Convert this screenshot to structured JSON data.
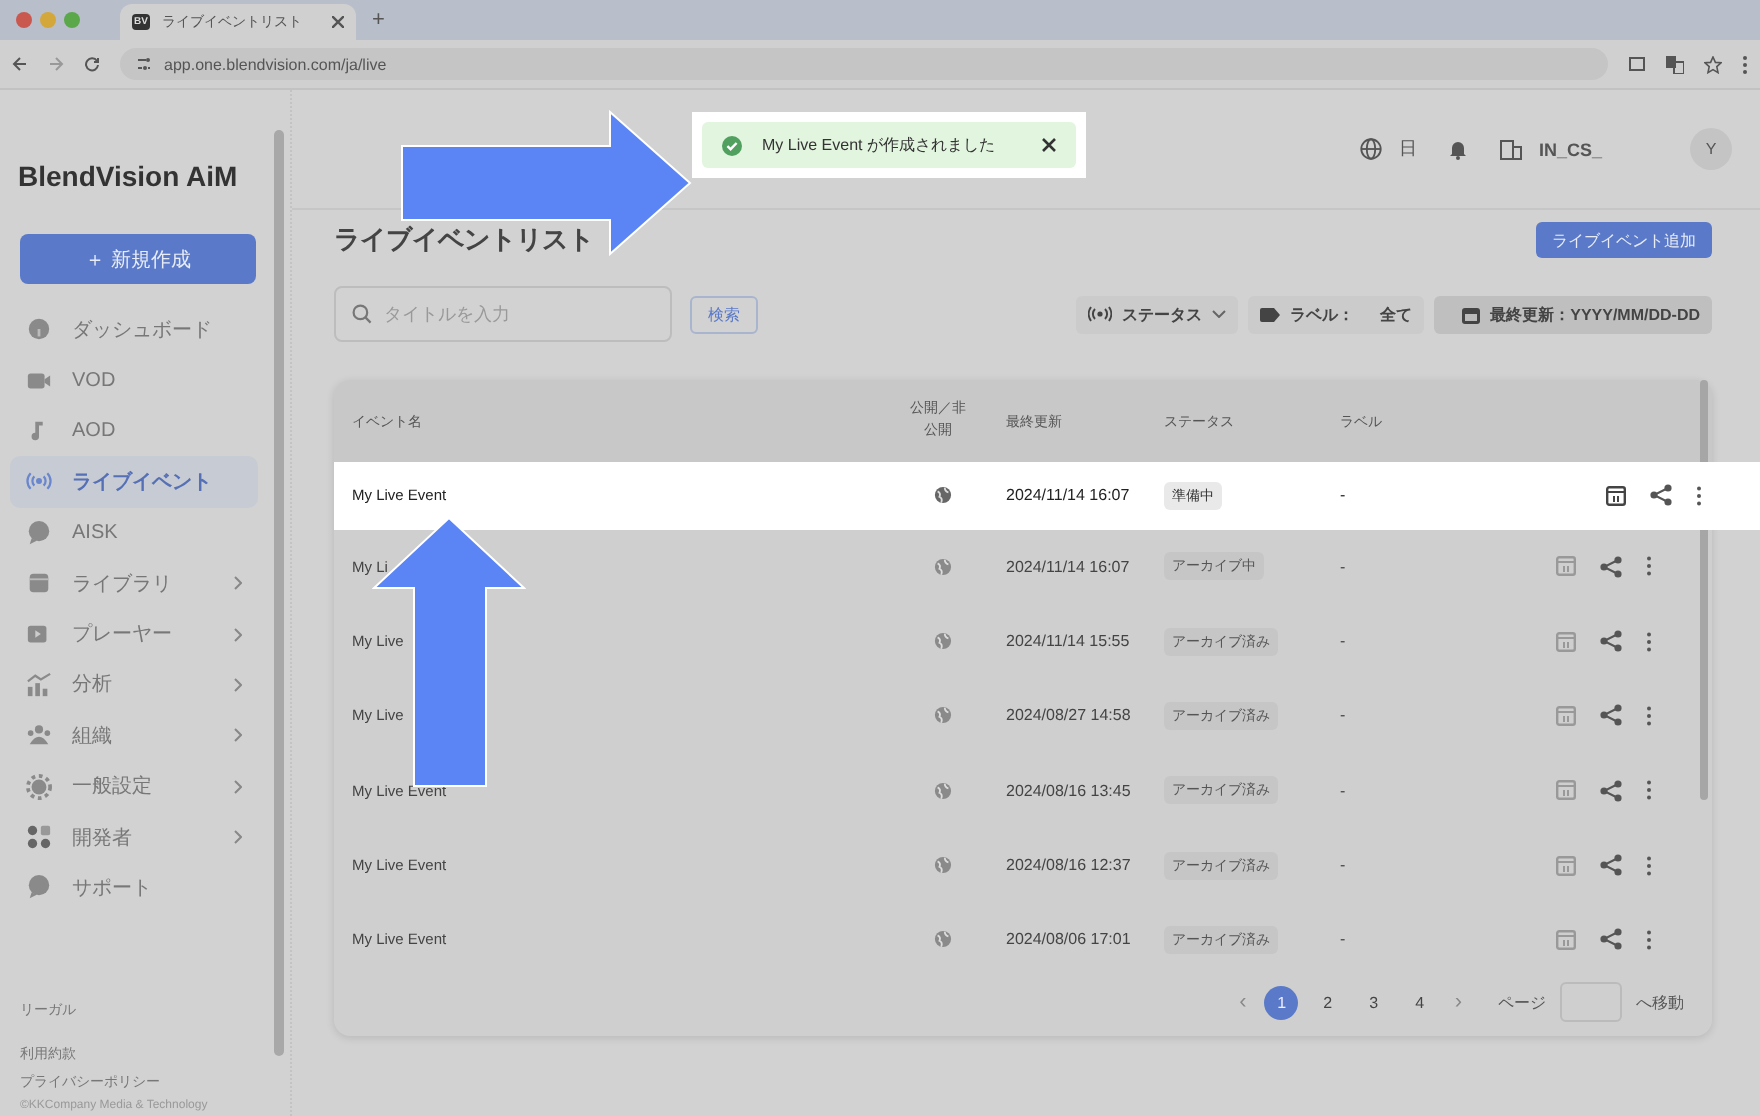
{
  "browser": {
    "tab_favicon": "BV",
    "tab_title": "ライブイベントリスト",
    "new_tab": "+",
    "url": "app.one.blendvision.com/ja/live"
  },
  "sidebar": {
    "logo": "BlendVision AiM",
    "new_button": "＋ 新規作成",
    "items": [
      {
        "label": "ダッシュボード",
        "selected": false,
        "expandable": false
      },
      {
        "label": "VOD",
        "selected": false,
        "expandable": false
      },
      {
        "label": "AOD",
        "selected": false,
        "expandable": false
      },
      {
        "label": "ライブイベント",
        "selected": true,
        "expandable": false
      },
      {
        "label": "AISK",
        "selected": false,
        "expandable": false
      },
      {
        "label": "ライブラリ",
        "selected": false,
        "expandable": true
      },
      {
        "label": "プレーヤー",
        "selected": false,
        "expandable": true
      },
      {
        "label": "分析",
        "selected": false,
        "expandable": true
      },
      {
        "label": "組織",
        "selected": false,
        "expandable": true
      },
      {
        "label": "一般設定",
        "selected": false,
        "expandable": true
      },
      {
        "label": "開発者",
        "selected": false,
        "expandable": true
      },
      {
        "label": "サポート",
        "selected": false,
        "expandable": false
      }
    ],
    "footer": {
      "heading": "リーガル",
      "links": [
        "利用約款",
        "プライバシーポリシー"
      ],
      "copyright": "©KKCompany Media & Technology"
    }
  },
  "header": {
    "language": "日",
    "organization": "IN_CS_",
    "avatar": "Y"
  },
  "toast": {
    "kind": "success",
    "message": "My Live Event が作成されました"
  },
  "page": {
    "title": "ライブイベントリスト",
    "add_button": "ライブイベント追加",
    "search": {
      "placeholder": "タイトルを入力",
      "button": "検索"
    },
    "filters": [
      {
        "kind": "status",
        "label": "ステータス"
      },
      {
        "kind": "label",
        "label": "ラベル：",
        "value": "全て"
      },
      {
        "kind": "date",
        "label": "最終更新：YYYY/MM/DD-DD"
      }
    ]
  },
  "table": {
    "columns": [
      "イベント名",
      "公開／非公開",
      "最終更新",
      "ステータス",
      "ラベル"
    ],
    "rows": [
      {
        "name": "My Live Event",
        "updated": "2024/11/14 16:07",
        "status": "準備中",
        "label": "-",
        "highlighted": true
      },
      {
        "name": "My Li",
        "updated": "2024/11/14 16:07",
        "status": "アーカイブ中",
        "label": "-",
        "highlighted": false
      },
      {
        "name": "My Live",
        "updated": "2024/11/14 15:55",
        "status": "アーカイブ済み",
        "label": "-",
        "highlighted": false
      },
      {
        "name": "My Live",
        "updated": "2024/08/27 14:58",
        "status": "アーカイブ済み",
        "label": "-",
        "highlighted": false
      },
      {
        "name": "My Live Event",
        "updated": "2024/08/16 13:45",
        "status": "アーカイブ済み",
        "label": "-",
        "highlighted": false
      },
      {
        "name": "My Live Event",
        "updated": "2024/08/16 12:37",
        "status": "アーカイブ済み",
        "label": "-",
        "highlighted": false
      },
      {
        "name": "My Live Event",
        "updated": "2024/08/06 17:01",
        "status": "アーカイブ済み",
        "label": "-",
        "highlighted": false
      }
    ]
  },
  "pagination": {
    "prev": "‹",
    "pages": [
      {
        "label": "1",
        "selected": true
      },
      {
        "label": "2",
        "selected": false
      },
      {
        "label": "3",
        "selected": false
      },
      {
        "label": "4",
        "selected": false
      }
    ],
    "next": "›",
    "page_label": "ページ",
    "goto": "へ移動"
  }
}
